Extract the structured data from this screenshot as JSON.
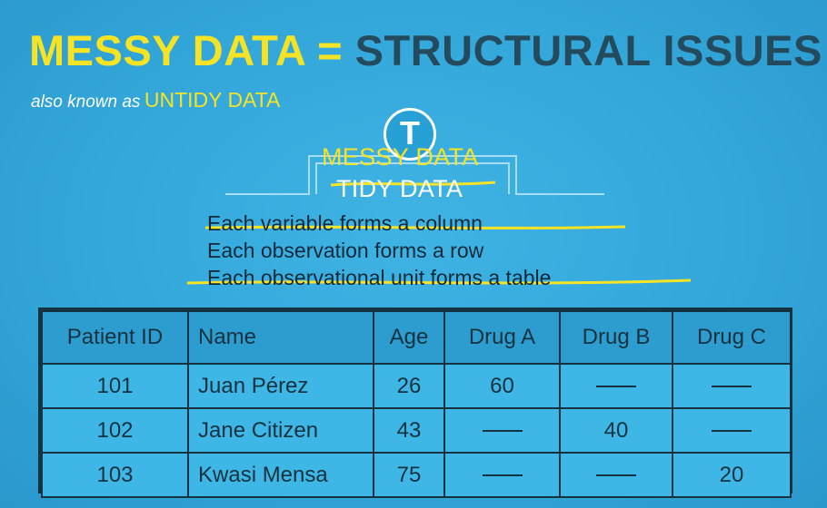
{
  "title": {
    "part1": "MESSY DATA =",
    "part2": "STRUCTURAL ISSUES"
  },
  "subtitle": {
    "small": "also known as",
    "big": "UNTIDY DATA"
  },
  "badge": {
    "letter": "T"
  },
  "diagram": {
    "messy_label": "MESSY DATA",
    "tidy_label": "TIDY DATA",
    "rules": [
      "Each variable forms a column",
      "Each observation forms a row",
      "Each observational unit forms a table"
    ]
  },
  "colors": {
    "background": "#33a7da",
    "accent_yellow": "#f5e326",
    "dark_text": "#244a5e",
    "table_line": "#14323f"
  },
  "table": {
    "headers": [
      "Patient ID",
      "Name",
      "Age",
      "Drug A",
      "Drug B",
      "Drug C"
    ],
    "rows": [
      [
        "101",
        "Juan Pérez",
        "26",
        "60",
        "—",
        "—"
      ],
      [
        "102",
        "Jane Citizen",
        "43",
        "—",
        "40",
        "—"
      ],
      [
        "103",
        "Kwasi Mensa",
        "75",
        "—",
        "—",
        "20"
      ]
    ]
  }
}
